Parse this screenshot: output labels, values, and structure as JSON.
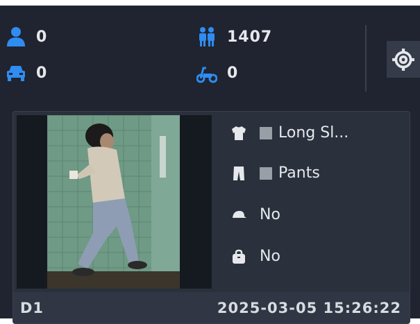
{
  "counters": {
    "person": {
      "icon": "person-icon",
      "value": "0"
    },
    "crowd": {
      "icon": "people-icon",
      "value": "1407"
    },
    "vehicle": {
      "icon": "car-icon",
      "value": "0"
    },
    "nonmotor": {
      "icon": "scooter-icon",
      "value": "0"
    }
  },
  "settings": {
    "icon": "gear-icon"
  },
  "record": {
    "attributes": [
      {
        "icon": "top-clothing-icon",
        "color": "#9a9ea6",
        "label": "Long Sl..."
      },
      {
        "icon": "pants-icon",
        "color": "#9a9ea6",
        "label": "Pants"
      },
      {
        "icon": "hat-icon",
        "label": "No"
      },
      {
        "icon": "bag-icon",
        "label": "No"
      }
    ],
    "channel": "D1",
    "timestamp": "2025-03-05 15:26:22"
  },
  "colors": {
    "accent": "#2f8cf0",
    "panel": "#1f2430",
    "card": "#2a303c"
  }
}
